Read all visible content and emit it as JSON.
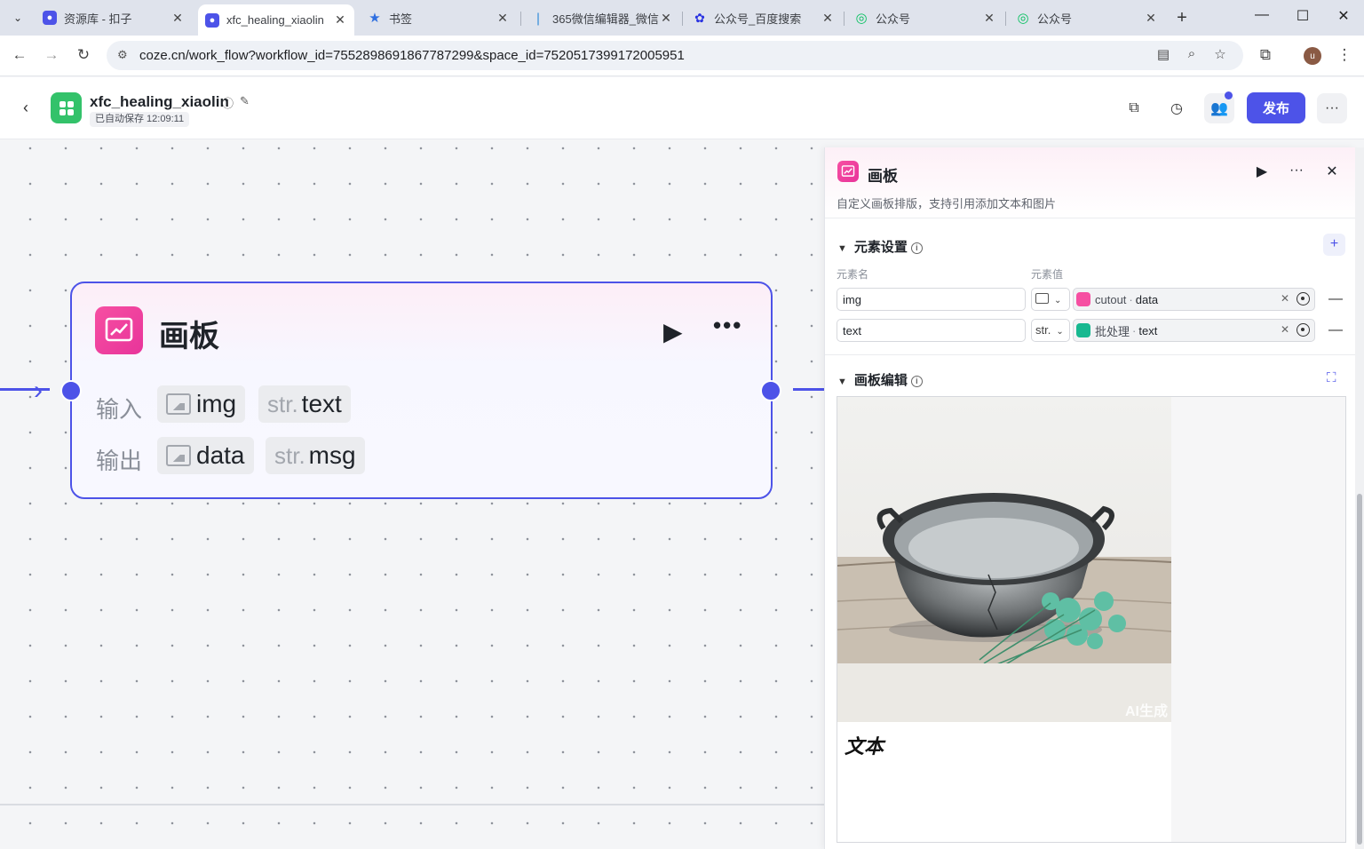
{
  "browser": {
    "tabs": [
      {
        "title": "资源库 - 扣子",
        "active": false,
        "fav_color": "#4d53e8"
      },
      {
        "title": "xfc_healing_xiaolin",
        "active": true,
        "fav_color": "#4d53e8"
      },
      {
        "title": "书签",
        "active": false,
        "fav_color": "#2f6fe0"
      },
      {
        "title": "365微信编辑器_微信",
        "active": false,
        "fav_color": "#2b88d8"
      },
      {
        "title": "公众号_百度搜索",
        "active": false,
        "fav_color": "#2932e1"
      },
      {
        "title": "公众号",
        "active": false,
        "fav_color": "#07c160"
      },
      {
        "title": "公众号",
        "active": false,
        "fav_color": "#07c160"
      }
    ],
    "url": "coze.cn/work_flow?workflow_id=7552898691867787299&space_id=7520517399172005951",
    "profile_initial": "u"
  },
  "header": {
    "title": "xfc_healing_xiaolin",
    "autosave": "已自动保存 12:09:11",
    "publish_label": "发布"
  },
  "node": {
    "title": "画板",
    "input_label": "输入",
    "output_label": "输出",
    "inputs": [
      {
        "type": "image",
        "name": "img"
      },
      {
        "type": "str",
        "type_label": "str.",
        "name": "text"
      }
    ],
    "outputs": [
      {
        "type": "image",
        "name": "data"
      },
      {
        "type": "str",
        "type_label": "str.",
        "name": "msg"
      }
    ]
  },
  "panel": {
    "title": "画板",
    "description": "自定义画板排版，支持引用添加文本和图片",
    "elements_section": "元素设置",
    "col_name": "元素名",
    "col_value": "元素值",
    "elements": [
      {
        "name": "img",
        "type_label": "",
        "type": "image",
        "source": "cutout",
        "field": "data",
        "source_color": "#f64fa2"
      },
      {
        "name": "text",
        "type_label": "str.",
        "type": "str",
        "source": "批处理",
        "field": "text",
        "source_color": "#17b890"
      }
    ],
    "board_section": "画板编辑",
    "board_text": "文本",
    "ai_mark": "AI生成"
  },
  "colors": {
    "accent": "#4d53e8",
    "node_pink": "#f64fa2",
    "logo_green": "#33c26a"
  }
}
